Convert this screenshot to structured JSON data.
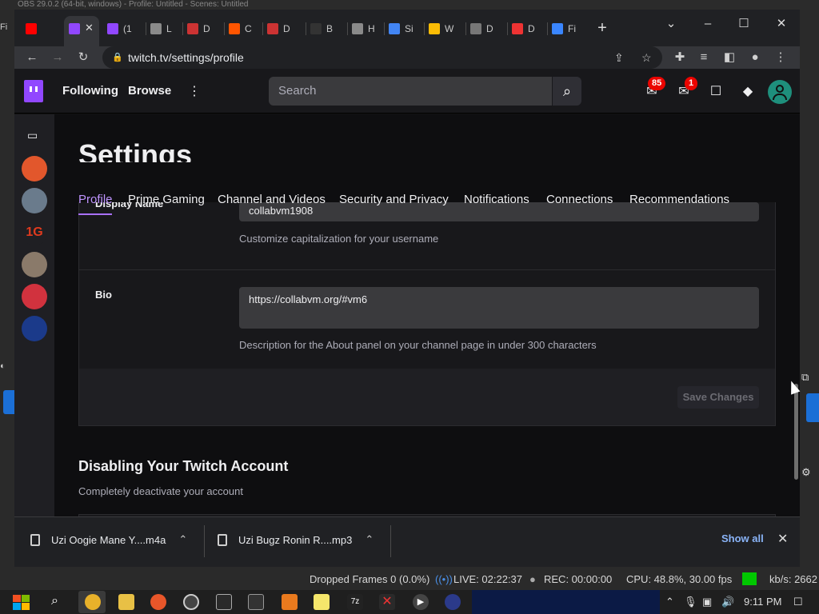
{
  "obs": {
    "title": "OBS 29.0.2 (64-bit, windows) - Profile: Untitled - Scenes: Untitled",
    "menu_first": "Fi",
    "status": {
      "dropped": "Dropped Frames 0 (0.0%)",
      "live": "LIVE: 02:22:37",
      "rec": "REC: 00:00:00",
      "cpu": "CPU: 48.8%, 30.00 fps",
      "kbs": "kb/s: 2662"
    }
  },
  "browser": {
    "tabs": [
      {
        "label": "",
        "icon": "youtube-icon",
        "color": "#ff0000"
      },
      {
        "label": "",
        "icon": "twitch-icon",
        "color": "#9147ff"
      },
      {
        "label": "(1",
        "icon": "twitch-icon",
        "color": "#9147ff"
      },
      {
        "label": "L",
        "icon": "globe-icon",
        "color": "#8a8a8a"
      },
      {
        "label": "D",
        "icon": "x-icon",
        "color": "#c33"
      },
      {
        "label": "C",
        "icon": "square-icon",
        "color": "#ff5500"
      },
      {
        "label": "D",
        "icon": "store-icon",
        "color": "#c33"
      },
      {
        "label": "B",
        "icon": "b-icon",
        "color": "#333"
      },
      {
        "label": "H",
        "icon": "globe-icon",
        "color": "#8a8a8a"
      },
      {
        "label": "Si",
        "icon": "google-icon",
        "color": "#4285f4"
      },
      {
        "label": "W",
        "icon": "photo-icon",
        "color": "#fbbc05"
      },
      {
        "label": "D",
        "icon": "download-icon",
        "color": "#777"
      },
      {
        "label": "D",
        "icon": "flag-icon",
        "color": "#e33"
      },
      {
        "label": "Fi",
        "icon": "stream-icon",
        "color": "#3a86ff"
      }
    ],
    "url": "twitch.tv/settings/profile"
  },
  "twitch": {
    "nav": {
      "following": "Following",
      "browse": "Browse",
      "search_placeholder": "Search",
      "notif_count": "85",
      "inbox_count": "1"
    },
    "settings_title": "Settings",
    "tabs": [
      "Profile",
      "Prime Gaming",
      "Channel and Videos",
      "Security and Privacy",
      "Notifications",
      "Connections",
      "Recommendations"
    ],
    "display_name": {
      "label": "Display Name",
      "value": "collabvm1908",
      "help": "Customize capitalization for your username"
    },
    "bio": {
      "label": "Bio",
      "value": "https://collabvm.org/#vm6",
      "help": "Description for the About panel on your channel page in under 300 characters"
    },
    "save_label": "Save Changes",
    "disable_heading": "Disabling Your Twitch Account",
    "disable_sub": "Completely deactivate your account"
  },
  "downloads": {
    "items": [
      "Uzi Oogie Mane Y....m4a",
      "Uzi Bugz Ronin R....mp3"
    ],
    "show_all": "Show all"
  },
  "taskbar": {
    "clock": "9:11 PM"
  }
}
